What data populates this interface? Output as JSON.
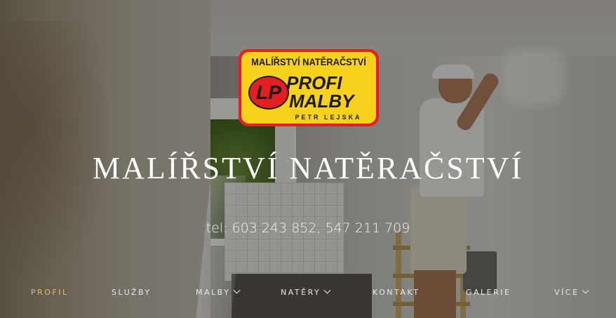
{
  "logo": {
    "top_text": "MALÍŘSTVÍ NATĚRAČSTVÍ",
    "monogram": "LP",
    "line1": "PROFI",
    "line2": "MALBY",
    "owner": "PETR LEJSKA",
    "colors": {
      "border": "#e31f22",
      "fill": "#f8d11a"
    }
  },
  "hero": {
    "title": "MALÍŘSTVÍ NATĚRAČSTVÍ",
    "phone": "tel: 603 243 852, 547 211 709"
  },
  "nav": {
    "items": [
      {
        "label": "PROFIL",
        "active": true
      },
      {
        "label": "SLUŽBY"
      },
      {
        "label": "MALBY",
        "icon": "chevron-down-icon"
      },
      {
        "label": "NATĚRY",
        "icon": "chevron-down-icon"
      },
      {
        "label": "KONTAKT"
      },
      {
        "label": "GALERIE"
      },
      {
        "label": "VÍCE",
        "icon": "chevron-down-icon"
      }
    ],
    "active_color": "#e2b978"
  }
}
